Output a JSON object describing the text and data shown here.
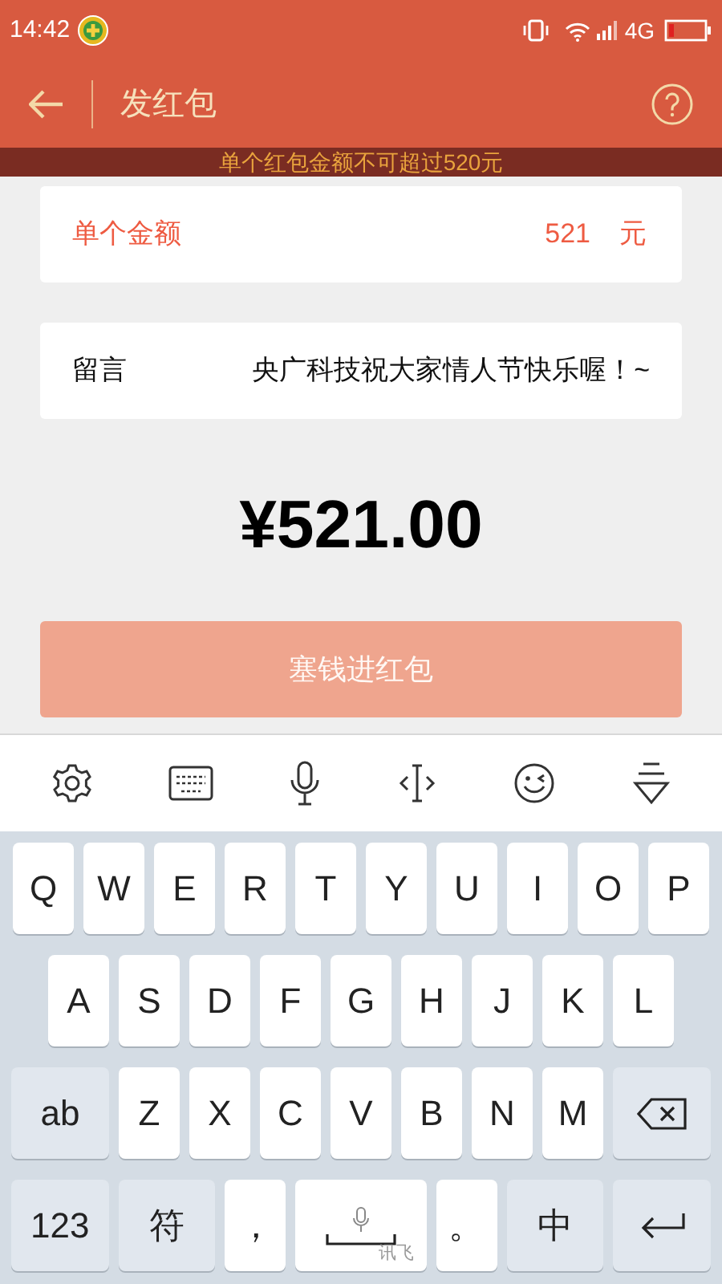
{
  "status_bar": {
    "time": "14:42",
    "network": "4G"
  },
  "header": {
    "title": "发红包"
  },
  "warning": "单个红包金额不可超过520元",
  "amount_field": {
    "label": "单个金额",
    "value": "521",
    "unit": "元"
  },
  "message_field": {
    "label": "留言",
    "value": "央广科技祝大家情人节快乐喔！~"
  },
  "total": "¥521.00",
  "submit_button": {
    "label": "塞钱进红包",
    "disabled": true
  },
  "keyboard": {
    "rows": [
      [
        {
          "kind": "letter",
          "label": "Q"
        },
        {
          "kind": "letter",
          "label": "W"
        },
        {
          "kind": "letter",
          "label": "E"
        },
        {
          "kind": "letter",
          "label": "R"
        },
        {
          "kind": "letter",
          "label": "T"
        },
        {
          "kind": "letter",
          "label": "Y"
        },
        {
          "kind": "letter",
          "label": "U"
        },
        {
          "kind": "letter",
          "label": "I"
        },
        {
          "kind": "letter",
          "label": "O"
        },
        {
          "kind": "letter",
          "label": "P"
        }
      ],
      [
        {
          "kind": "letter",
          "label": "A"
        },
        {
          "kind": "letter",
          "label": "S"
        },
        {
          "kind": "letter",
          "label": "D"
        },
        {
          "kind": "letter",
          "label": "F"
        },
        {
          "kind": "letter",
          "label": "G"
        },
        {
          "kind": "letter",
          "label": "H"
        },
        {
          "kind": "letter",
          "label": "J"
        },
        {
          "kind": "letter",
          "label": "K"
        },
        {
          "kind": "letter",
          "label": "L"
        }
      ],
      [
        {
          "kind": "function",
          "label": "ab"
        },
        {
          "kind": "letter",
          "label": "Z"
        },
        {
          "kind": "letter",
          "label": "X"
        },
        {
          "kind": "letter",
          "label": "C"
        },
        {
          "kind": "letter",
          "label": "V"
        },
        {
          "kind": "letter",
          "label": "B"
        },
        {
          "kind": "letter",
          "label": "N"
        },
        {
          "kind": "letter",
          "label": "M"
        },
        {
          "kind": "backspace"
        }
      ],
      [
        {
          "kind": "function",
          "label": "123"
        },
        {
          "kind": "function",
          "label": "符"
        },
        {
          "kind": "letter",
          "label": "，"
        },
        {
          "kind": "space",
          "label": "讯飞"
        },
        {
          "kind": "letter",
          "label": "。"
        },
        {
          "kind": "function",
          "label": "中"
        },
        {
          "kind": "enter"
        }
      ]
    ]
  }
}
